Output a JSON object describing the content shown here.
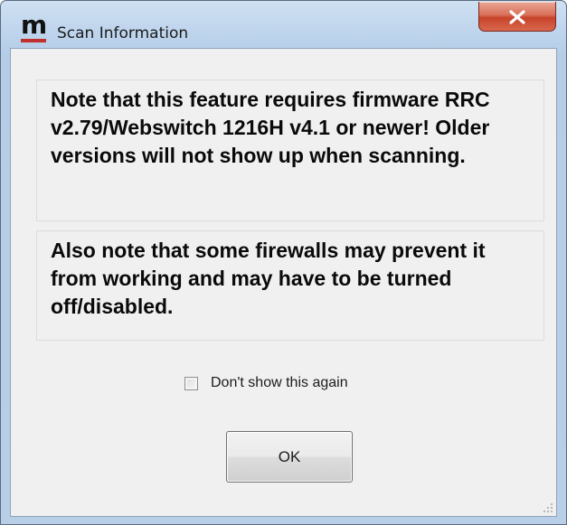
{
  "window": {
    "title": "Scan Information",
    "logo_letter": "m",
    "accent_color": "#c0302e",
    "close_icon": "close-icon"
  },
  "notes": {
    "note_1": "Note that this feature requires firmware RRC v2.79/Webswitch 1216H v4.1 or newer! Older versions will not show up when scanning.",
    "note_2": "Also note that some firewalls may prevent it from working and may have to be turned off/disabled."
  },
  "options": {
    "dont_show_label": "Don't show this again",
    "dont_show_checked": false
  },
  "buttons": {
    "ok_label": "OK"
  }
}
